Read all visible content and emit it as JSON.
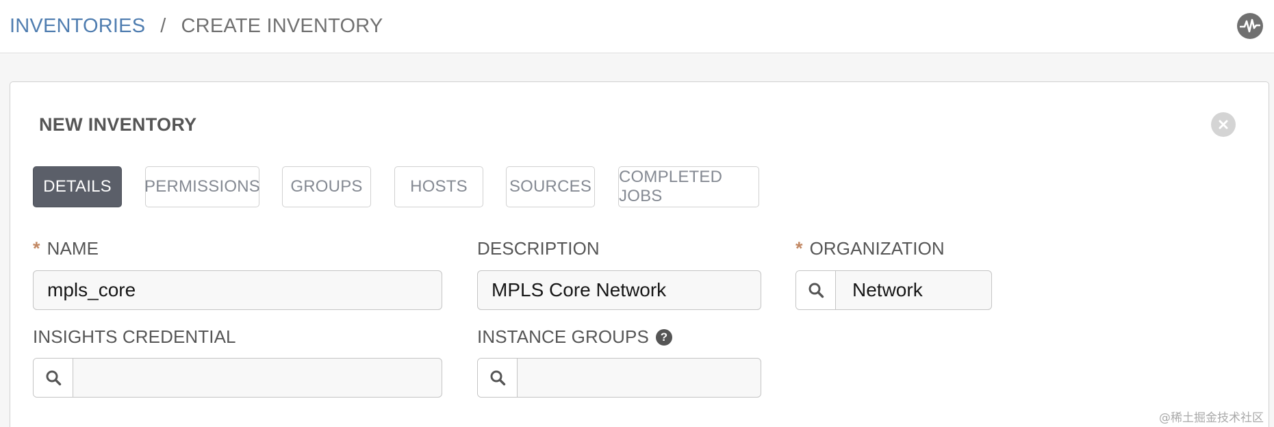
{
  "breadcrumb": {
    "root": "INVENTORIES",
    "separator": "/",
    "current": "CREATE INVENTORY"
  },
  "header_icon": "activity-stream-icon",
  "panel": {
    "title": "NEW INVENTORY",
    "close_icon": "close-icon"
  },
  "tabs": [
    {
      "label": "DETAILS",
      "active": true
    },
    {
      "label": "PERMISSIONS",
      "active": false
    },
    {
      "label": "GROUPS",
      "active": false
    },
    {
      "label": "HOSTS",
      "active": false
    },
    {
      "label": "SOURCES",
      "active": false
    },
    {
      "label": "COMPLETED JOBS",
      "active": false
    }
  ],
  "form": {
    "required_marker": "*",
    "name": {
      "label": "NAME",
      "value": "mpls_core",
      "required": true
    },
    "description": {
      "label": "DESCRIPTION",
      "value": "MPLS Core Network"
    },
    "organization": {
      "label": "ORGANIZATION",
      "value": "Network",
      "required": true
    },
    "insights_credential": {
      "label": "INSIGHTS CREDENTIAL",
      "value": ""
    },
    "instance_groups": {
      "label": "INSTANCE GROUPS",
      "value": "",
      "help": "?"
    }
  },
  "watermark": "@稀土掘金技术社区",
  "colors": {
    "link": "#4f7db0",
    "active_tab": "#5b5f69",
    "required": "#c28863"
  }
}
